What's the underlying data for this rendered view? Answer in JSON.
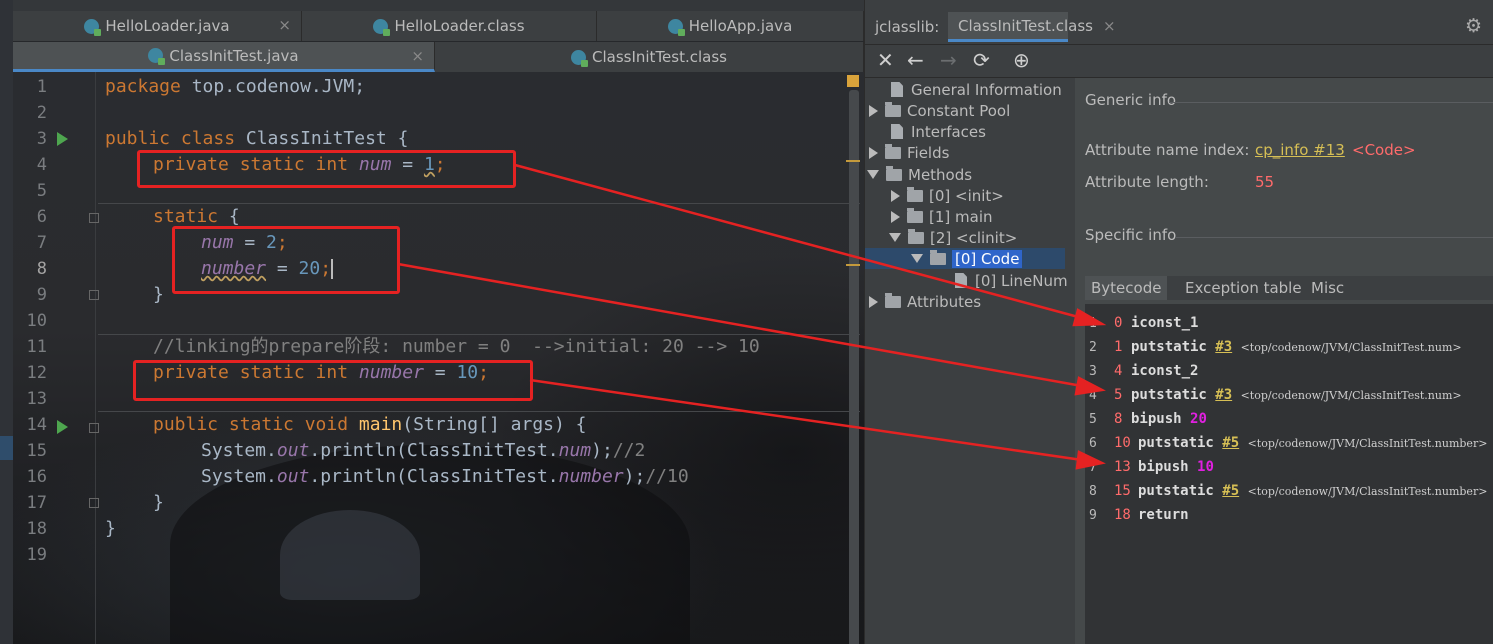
{
  "editor": {
    "tabs_row1": [
      {
        "label": "HelloLoader.java"
      },
      {
        "label": "HelloLoader.class"
      },
      {
        "label": "HelloApp.java"
      }
    ],
    "tabs_row2": [
      {
        "label": "ClassInitTest.java"
      },
      {
        "label": "ClassInitTest.class"
      }
    ],
    "close_glyph": "×",
    "line_numbers": [
      "1",
      "2",
      "3",
      "4",
      "5",
      "6",
      "7",
      "8",
      "9",
      "10",
      "11",
      "12",
      "13",
      "14",
      "15",
      "16",
      "17",
      "18",
      "19"
    ],
    "code": {
      "l1_kw": "package",
      "l1_rest": " top.codenow.JVM;",
      "l3_kw": "public class",
      "l3_rest": " ClassInitTest {",
      "l4_kw": "private static int",
      "l4_fld": "num",
      "l4_eq": " = ",
      "l4_val": "1",
      "l4_end": ";",
      "l6_kw": "static",
      "l6_rest": " {",
      "l7_fld": "num",
      "l7_eq": " = ",
      "l7_val": "2",
      "l7_end": ";",
      "l8_fld": "number",
      "l8_eq": " = ",
      "l8_val": "20",
      "l8_end": ";",
      "l9": "}",
      "l11": "//linking的prepare阶段: number = 0  -->initial: 20 --> 10",
      "l12_kw": "private static int",
      "l12_fld": "number",
      "l12_eq": " = ",
      "l12_val": "10",
      "l12_end": ";",
      "l14_kw": "public static void",
      "l14_fn": "main",
      "l14_rest": "(String[] args) {",
      "l15_a": "System.",
      "l15_out": "out",
      "l15_b": ".println(ClassInitTest.",
      "l15_fld": "num",
      "l15_c": ");",
      "l15_cmt": "//2",
      "l16_a": "System.",
      "l16_out": "out",
      "l16_b": ".println(ClassInitTest.",
      "l16_fld": "number",
      "l16_c": ");",
      "l16_cmt": "//10",
      "l17": "}",
      "l18": "}"
    }
  },
  "jclasslib": {
    "title": "jclasslib:",
    "tab": "ClassInitTest.class",
    "tree": [
      {
        "label": "General Information"
      },
      {
        "label": "Constant Pool"
      },
      {
        "label": "Interfaces"
      },
      {
        "label": "Fields"
      },
      {
        "label": "Methods"
      },
      {
        "label": "[0] <init>"
      },
      {
        "label": "[1] main"
      },
      {
        "label": "[2] <clinit>"
      },
      {
        "label": "[0] Code"
      },
      {
        "label": "[0] LineNum"
      },
      {
        "label": "Attributes"
      }
    ],
    "generic_info": "Generic info",
    "attr_name_index_label": "Attribute name index:",
    "attr_name_index_link": "cp_info #13",
    "attr_name_index_value": "<Code>",
    "attr_length_label": "Attribute length:",
    "attr_length_value": "55",
    "specific_info": "Specific info",
    "bytecode_tabs": [
      "Bytecode",
      "Exception table",
      "Misc"
    ],
    "bytecode": [
      {
        "ln": "1",
        "off": "0",
        "ins": "iconst_1"
      },
      {
        "ln": "2",
        "off": "1",
        "ins": "putstatic",
        "ref": "#3",
        "cmt": "<top/codenow/JVM/ClassInitTest.num>"
      },
      {
        "ln": "3",
        "off": "4",
        "ins": "iconst_2"
      },
      {
        "ln": "4",
        "off": "5",
        "ins": "putstatic",
        "ref": "#3",
        "cmt": "<top/codenow/JVM/ClassInitTest.num>"
      },
      {
        "ln": "5",
        "off": "8",
        "ins": "bipush",
        "val": "20"
      },
      {
        "ln": "6",
        "off": "10",
        "ins": "putstatic",
        "ref": "#5",
        "cmt": "<top/codenow/JVM/ClassInitTest.number>"
      },
      {
        "ln": "7",
        "off": "13",
        "ins": "bipush",
        "val": "10"
      },
      {
        "ln": "8",
        "off": "15",
        "ins": "putstatic",
        "ref": "#5",
        "cmt": "<top/codenow/JVM/ClassInitTest.number>"
      },
      {
        "ln": "9",
        "off": "18",
        "ins": "return"
      }
    ]
  },
  "colors": {
    "annotation": "#e52222",
    "keyword": "#cc7832",
    "field": "#9876aa",
    "number": "#6897bb",
    "selection": "#2f65ca"
  }
}
